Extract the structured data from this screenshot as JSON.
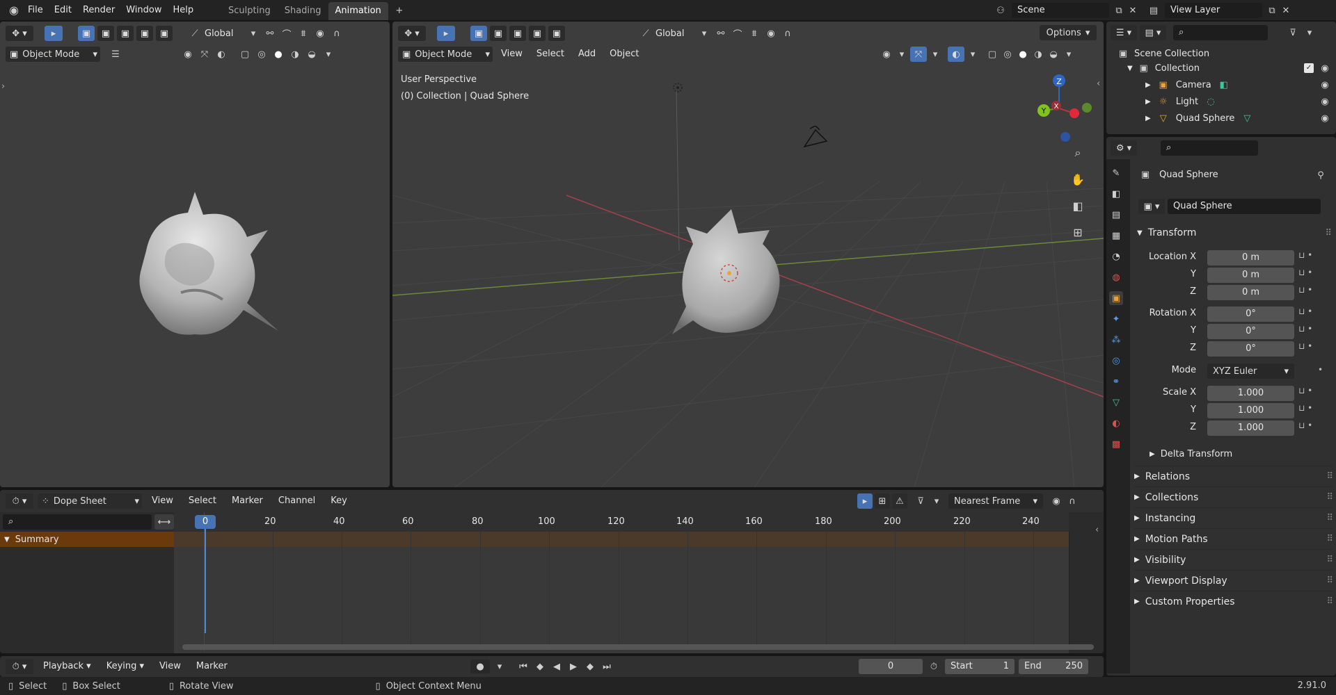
{
  "menu": {
    "file": "File",
    "edit": "Edit",
    "render": "Render",
    "window": "Window",
    "help": "Help"
  },
  "workspaces": [
    {
      "label": "Sculpting"
    },
    {
      "label": "Shading"
    },
    {
      "label": "Animation"
    }
  ],
  "scene": {
    "label": "Scene"
  },
  "view_layer": {
    "label": "View Layer"
  },
  "left_view": {
    "orientation": "Global",
    "mode": "Object Mode"
  },
  "main_view": {
    "orientation": "Global",
    "mode": "Object Mode",
    "menus": [
      "View",
      "Select",
      "Add",
      "Object"
    ],
    "options": "Options",
    "perspective": "User Perspective",
    "collection_info": "(0) Collection | Quad Sphere",
    "gizmo": {
      "x": "X",
      "y": "Y",
      "z": "Z"
    }
  },
  "outliner": {
    "root": "Scene Collection",
    "collection": "Collection",
    "items": [
      {
        "label": "Camera"
      },
      {
        "label": "Light"
      },
      {
        "label": "Quad Sphere"
      }
    ]
  },
  "properties": {
    "object_name": "Quad Sphere",
    "datablock": "Quad Sphere",
    "transform": "Transform",
    "location": {
      "label": "Location X",
      "y": "Y",
      "z": "Z",
      "x_val": "0 m",
      "y_val": "0 m",
      "z_val": "0 m"
    },
    "rotation": {
      "label": "Rotation X",
      "y": "Y",
      "z": "Z",
      "x_val": "0°",
      "y_val": "0°",
      "z_val": "0°"
    },
    "mode": {
      "label": "Mode",
      "value": "XYZ Euler"
    },
    "scale": {
      "label": "Scale X",
      "y": "Y",
      "z": "Z",
      "x_val": "1.000",
      "y_val": "1.000",
      "z_val": "1.000"
    },
    "delta": "Delta Transform",
    "sections": [
      "Relations",
      "Collections",
      "Instancing",
      "Motion Paths",
      "Visibility",
      "Viewport Display",
      "Custom Properties"
    ]
  },
  "dopesheet": {
    "editor": "Dope Sheet",
    "menus": [
      "View",
      "Select",
      "Marker",
      "Channel",
      "Key"
    ],
    "snap": "Nearest Frame",
    "summary": "Summary",
    "current_frame_badge": "0",
    "ticks": [
      "20",
      "40",
      "60",
      "80",
      "100",
      "120",
      "140",
      "160",
      "180",
      "200",
      "220",
      "240"
    ]
  },
  "timeline": {
    "playback": "Playback",
    "keying": "Keying",
    "view": "View",
    "marker": "Marker",
    "frame": "0",
    "start_label": "Start",
    "start": "1",
    "end_label": "End",
    "end": "250"
  },
  "status": {
    "select": "Select",
    "box_select": "Box Select",
    "rotate": "Rotate View",
    "context": "Object Context Menu",
    "version": "2.91.0"
  }
}
